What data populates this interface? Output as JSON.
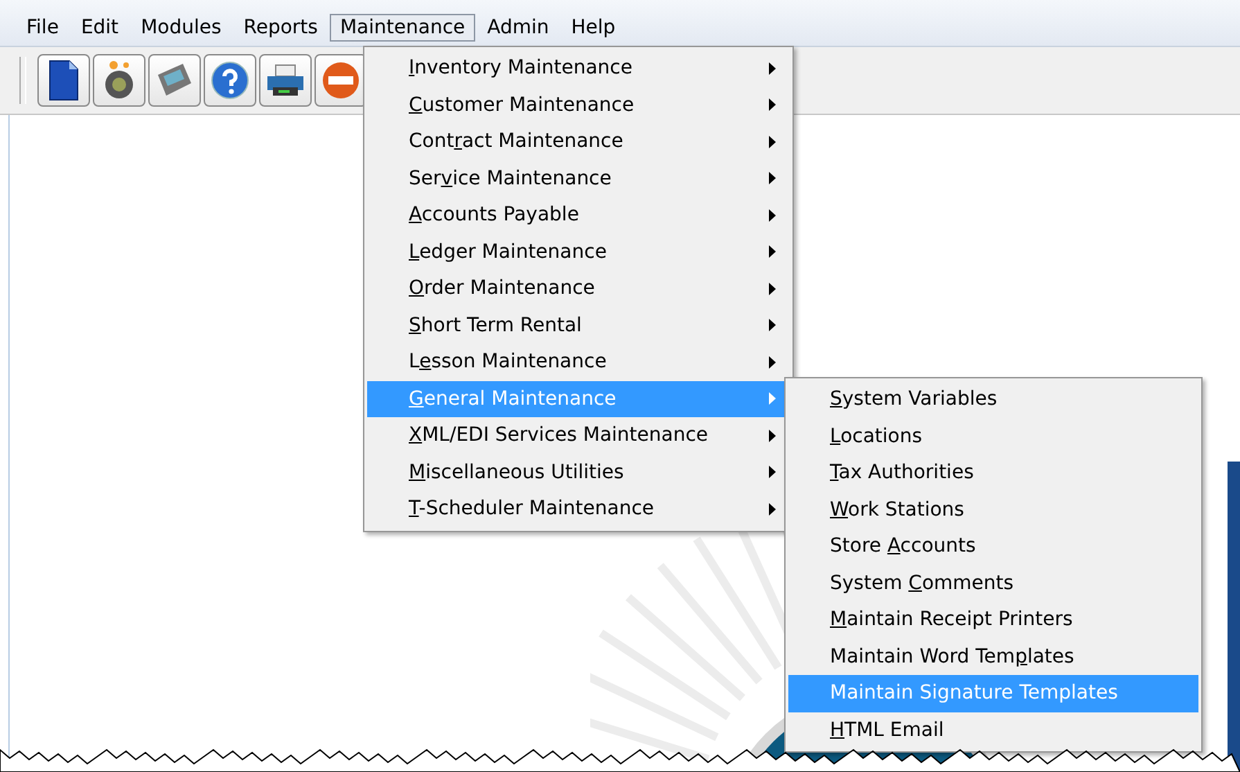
{
  "menu_bar": [
    {
      "label": "File",
      "selected": false
    },
    {
      "label": "Edit",
      "selected": false
    },
    {
      "label": "Modules",
      "selected": false
    },
    {
      "label": "Reports",
      "selected": false
    },
    {
      "label": "Maintenance",
      "selected": true
    },
    {
      "label": "Admin",
      "selected": false
    },
    {
      "label": "Help",
      "selected": false
    }
  ],
  "toolbar": {
    "buttons": [
      {
        "kind": "document"
      },
      {
        "kind": "webcam"
      },
      {
        "kind": "register"
      },
      {
        "kind": "help"
      },
      {
        "kind": "printer"
      },
      {
        "kind": "stop"
      }
    ]
  },
  "maintenance_menu": [
    {
      "key": "I",
      "post": "nventory Maintenance",
      "submenu": true,
      "selected": false
    },
    {
      "key": "C",
      "post": "ustomer Maintenance",
      "submenu": true,
      "selected": false
    },
    {
      "pre": "Cont",
      "key": "r",
      "post": "act Maintenance",
      "submenu": true,
      "selected": false
    },
    {
      "pre": "Ser",
      "key": "v",
      "post": "ice Maintenance",
      "submenu": true,
      "selected": false
    },
    {
      "key": "A",
      "post": "ccounts Payable",
      "submenu": true,
      "selected": false
    },
    {
      "key": "L",
      "post": "edger Maintenance",
      "submenu": true,
      "selected": false
    },
    {
      "key": "O",
      "post": "rder Maintenance",
      "submenu": true,
      "selected": false
    },
    {
      "key": "S",
      "post": "hort Term Rental",
      "submenu": true,
      "selected": false
    },
    {
      "pre": "L",
      "key": "e",
      "post": "sson Maintenance",
      "submenu": true,
      "selected": false
    },
    {
      "key": "G",
      "post": "eneral Maintenance",
      "submenu": true,
      "selected": true
    },
    {
      "key": "X",
      "post": "ML/EDI Services Maintenance",
      "submenu": true,
      "selected": false
    },
    {
      "key": "M",
      "post": "iscellaneous Utilities",
      "submenu": true,
      "selected": false
    },
    {
      "key": "T",
      "post": "-Scheduler Maintenance",
      "submenu": true,
      "selected": false
    }
  ],
  "general_maintenance_menu": [
    {
      "key": "S",
      "post": "ystem Variables",
      "submenu": false,
      "selected": false
    },
    {
      "key": "L",
      "post": "ocations",
      "submenu": false,
      "selected": false
    },
    {
      "key": "T",
      "post": "ax Authorities",
      "submenu": false,
      "selected": false
    },
    {
      "key": "W",
      "post": "ork Stations",
      "submenu": false,
      "selected": false
    },
    {
      "pre": "Store ",
      "key": "A",
      "post": "ccounts",
      "submenu": false,
      "selected": false
    },
    {
      "pre": "System ",
      "key": "C",
      "post": "omments",
      "submenu": false,
      "selected": false
    },
    {
      "key": "M",
      "post": "aintain Receipt Printers",
      "submenu": false,
      "selected": false
    },
    {
      "pre": "Maintain Word Tem",
      "key": "p",
      "post": "lates",
      "submenu": false,
      "selected": false
    },
    {
      "pre": "Maintain Signature Templates",
      "submenu": false,
      "selected": true
    },
    {
      "key": "H",
      "post": "TML Email",
      "submenu": false,
      "selected": false
    }
  ]
}
